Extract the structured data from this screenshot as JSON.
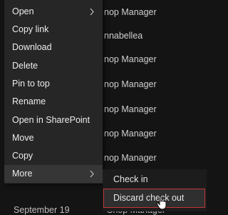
{
  "background": {
    "rows": [
      "nop Manager",
      "nnabellea",
      "nop Manager",
      "nop Manager",
      "nop Manager",
      "nop Manager",
      "nop Manager"
    ],
    "bottom_date": "September 19",
    "bottom_name": "Shop Manager"
  },
  "context_menu": {
    "items": [
      {
        "label": "Open",
        "has_submenu": true
      },
      {
        "label": "Copy link"
      },
      {
        "label": "Download"
      },
      {
        "label": "Delete"
      },
      {
        "label": "Pin to top"
      },
      {
        "label": "Rename"
      },
      {
        "label": "Open in SharePoint"
      },
      {
        "label": "Move"
      },
      {
        "label": "Copy"
      },
      {
        "label": "More",
        "has_submenu": true
      }
    ]
  },
  "submenu": {
    "items": [
      {
        "label": "Check in"
      },
      {
        "label": "Discard check out"
      }
    ]
  },
  "colors": {
    "menu_bg": "#262626",
    "hover_bg": "#363636",
    "highlight_border": "#c0353b"
  }
}
